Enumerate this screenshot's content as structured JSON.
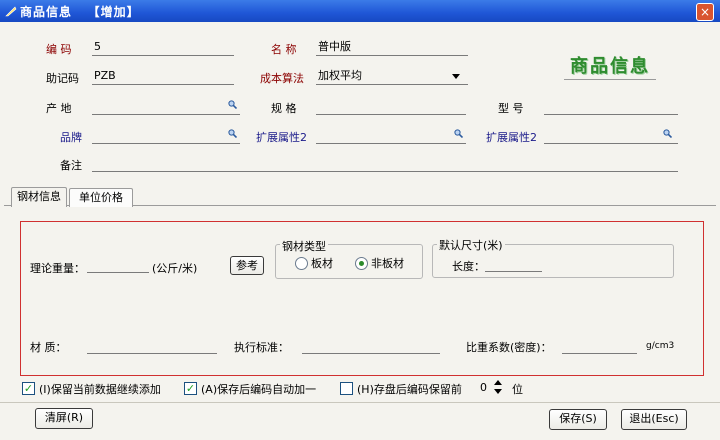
{
  "window": {
    "title": "商品信息",
    "mode": "【增加】",
    "close_symbol": "×"
  },
  "header_logo": "商品信息",
  "fields": {
    "code": {
      "label": "编  码",
      "value": "5"
    },
    "name": {
      "label": "名  称",
      "value": "普中版"
    },
    "mnemonic": {
      "label": "助记码",
      "value": "PZB"
    },
    "cost_method": {
      "label": "成本算法",
      "value": "加权平均"
    },
    "origin": {
      "label": "产  地",
      "value": ""
    },
    "spec": {
      "label": "规  格",
      "value": ""
    },
    "model": {
      "label": "型  号",
      "value": ""
    },
    "brand": {
      "label": "品牌",
      "value": ""
    },
    "ext_attr_1": {
      "label": "扩展属性2",
      "value": ""
    },
    "ext_attr_2": {
      "label": "扩展属性2",
      "value": ""
    },
    "remark": {
      "label": "备注",
      "value": ""
    }
  },
  "tabs": [
    {
      "label": "钢材信息",
      "active": true
    },
    {
      "label": "单位价格",
      "active": false
    }
  ],
  "steel": {
    "theoretical_weight_label": "理论重量：",
    "theoretical_weight_value": "",
    "theoretical_weight_unit": "(公斤/米)",
    "reference_button": "参考",
    "type_group": {
      "legend": "钢材类型",
      "options": [
        {
          "label": "板材",
          "selected": false
        },
        {
          "label": "非板材",
          "selected": true
        }
      ]
    },
    "default_size_group": {
      "legend": "默认尺寸(米)",
      "length_label": "长度：",
      "length_value": ""
    },
    "material_label": "材  质：",
    "material_value": "",
    "standard_label": "执行标准：",
    "standard_value": "",
    "density_label": "比重系数(密度)：",
    "density_value": "",
    "density_unit": "g/cm3"
  },
  "options": {
    "keep_data": {
      "label": "(I)保留当前数据继续添加",
      "checked": true
    },
    "auto_increment": {
      "label": "(A)保存后编码自动加一",
      "checked": true
    },
    "keep_prefix": {
      "label": "(H)存盘后编码保留前",
      "checked": false
    },
    "prefix_digits": "0",
    "prefix_unit": "位"
  },
  "buttons": {
    "clear": "清屏(R)",
    "save": "保存(S)",
    "exit": "退出(Esc)"
  },
  "colors": {
    "titlebar": "#1f56d6",
    "highlight_border": "#d03030",
    "logo": "#2f8c2f"
  }
}
